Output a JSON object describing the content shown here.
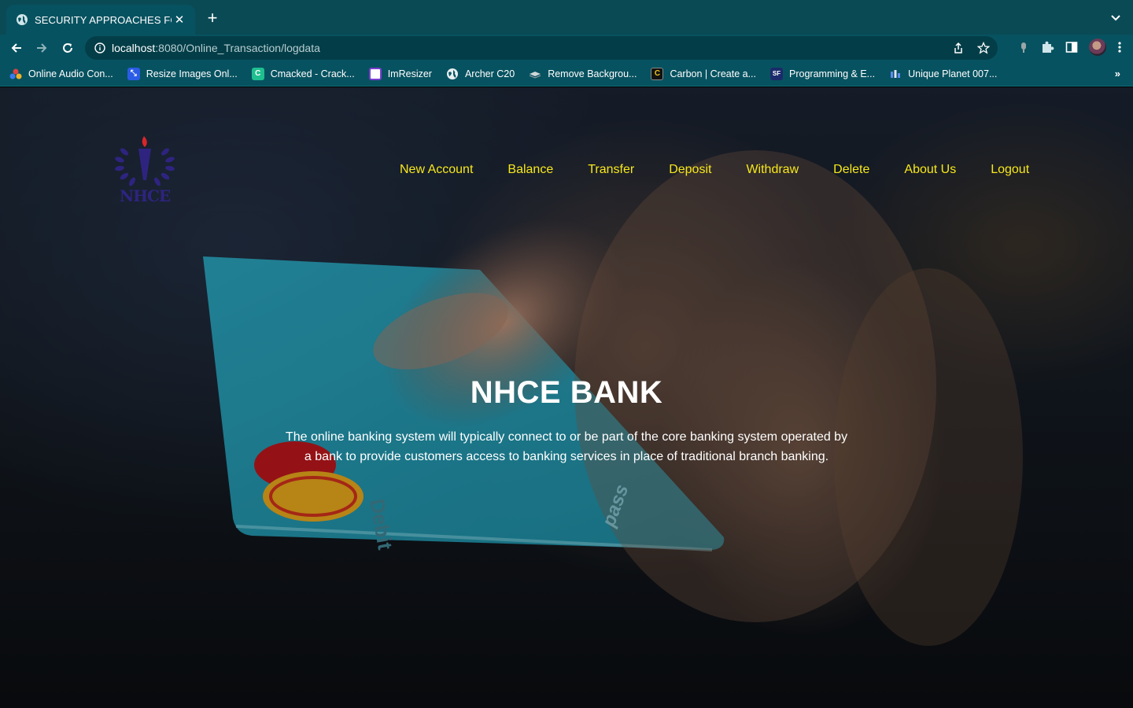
{
  "browser": {
    "tab_title": "SECURITY APPROACHES FOR",
    "url_host": "localhost",
    "url_path": ":8080/Online_Transaction/logdata",
    "bookmarks": [
      {
        "label": "Online Audio Con...",
        "icon": "multicolor-dots-icon"
      },
      {
        "label": "Resize Images Onl...",
        "icon": "resize-icon"
      },
      {
        "label": "Cmacked - Crack...",
        "icon": "c-icon"
      },
      {
        "label": "ImResizer",
        "icon": "imresizer-icon"
      },
      {
        "label": "Archer C20",
        "icon": "globe-icon"
      },
      {
        "label": "Remove Backgrou...",
        "icon": "layers-icon"
      },
      {
        "label": "Carbon | Create a...",
        "icon": "carbon-icon"
      },
      {
        "label": "Programming & E...",
        "icon": "programming-icon"
      },
      {
        "label": "Unique Planet 007...",
        "icon": "chart-icon"
      }
    ],
    "more_bookmarks": "»"
  },
  "site": {
    "logo_text": "NHCE",
    "nav": [
      "New Account",
      "Balance",
      "Transfer",
      "Deposit",
      "Withdraw",
      "Delete",
      "About Us",
      "Logout"
    ],
    "card_text": [
      "Debit",
      "pass"
    ]
  },
  "hero": {
    "title": "NHCE BANK",
    "line1": "The online banking system will typically connect to or be part of the core banking system operated by",
    "line2": "a bank to provide customers access to banking services in place of traditional branch banking."
  },
  "colors": {
    "nav_link": "#f7e81a",
    "chrome": "#075260",
    "logo": "#2e2480"
  }
}
